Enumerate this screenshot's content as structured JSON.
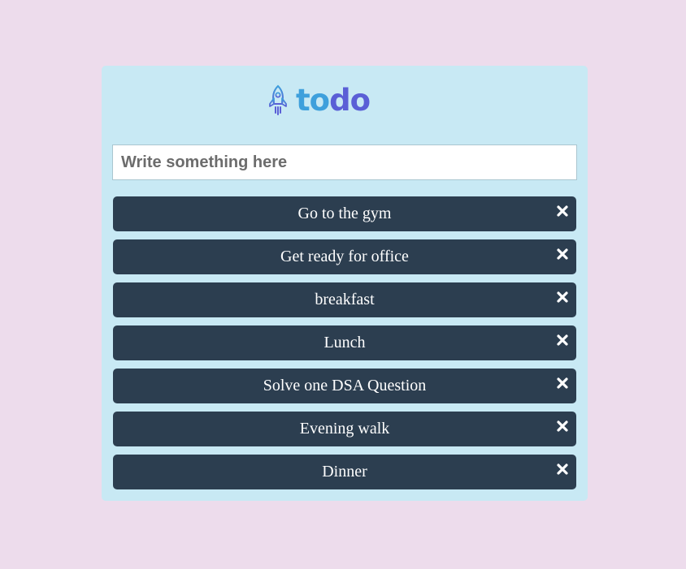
{
  "app": {
    "brand_part1": "to",
    "brand_part2": "do",
    "logo_icon": "rocket-icon"
  },
  "input": {
    "placeholder": "Write something here",
    "value": ""
  },
  "todos": [
    {
      "label": "Go to the gym"
    },
    {
      "label": "Get ready for office"
    },
    {
      "label": "breakfast"
    },
    {
      "label": "Lunch"
    },
    {
      "label": "Solve one DSA Question"
    },
    {
      "label": "Evening walk"
    },
    {
      "label": "Dinner"
    }
  ],
  "icons": {
    "delete": "close-icon"
  },
  "colors": {
    "page_background": "#eddcec",
    "card_background": "#c8e9f4",
    "item_background": "#2c3e50",
    "brand_blue": "#3ea0dc",
    "brand_purple": "#5a5fd6"
  }
}
